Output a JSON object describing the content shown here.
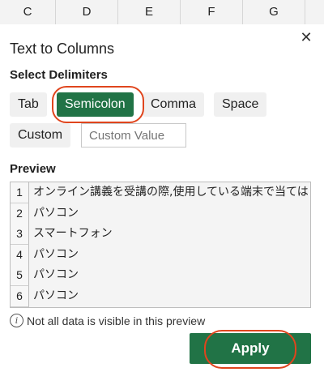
{
  "spreadsheet": {
    "columns": [
      "C",
      "D",
      "E",
      "F",
      "G"
    ]
  },
  "pane": {
    "title": "Text to Columns",
    "close_icon": "close-icon",
    "delimiters": {
      "label": "Select Delimiters",
      "options": [
        "Tab",
        "Semicolon",
        "Comma",
        "Space",
        "Custom"
      ],
      "selected": "Semicolon",
      "custom_placeholder": "Custom Value"
    },
    "preview": {
      "label": "Preview",
      "rows": [
        {
          "num": "1",
          "text": "オンライン講義を受講の際,使用している端末で当ては"
        },
        {
          "num": "2",
          "text": "パソコン"
        },
        {
          "num": "3",
          "text": "スマートフォン"
        },
        {
          "num": "4",
          "text": "パソコン"
        },
        {
          "num": "5",
          "text": "パソコン"
        },
        {
          "num": "6",
          "text": "パソコン"
        }
      ]
    },
    "info_text": "Not all data is visible in this preview",
    "apply_label": "Apply",
    "colors": {
      "accent": "#217346",
      "annotation": "#e0451d"
    }
  }
}
